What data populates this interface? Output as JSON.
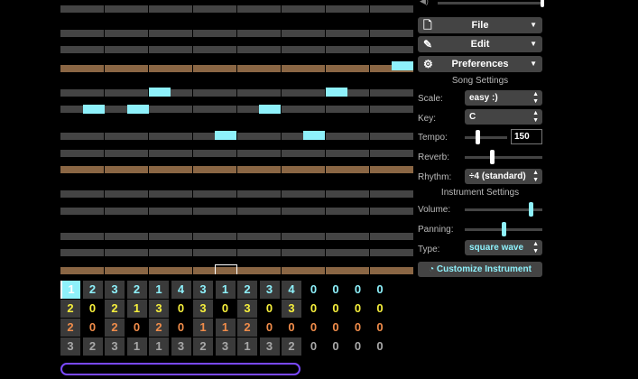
{
  "menus": {
    "file": {
      "label": "File",
      "icon": "file-icon"
    },
    "edit": {
      "label": "Edit",
      "icon": "pencil-icon"
    },
    "preferences": {
      "label": "Preferences",
      "icon": "gear-icon"
    }
  },
  "song_settings": {
    "title": "Song Settings",
    "scale_label": "Scale:",
    "scale_value": "easy :)",
    "key_label": "Key:",
    "key_value": "C",
    "tempo_label": "Tempo:",
    "tempo_value": "150",
    "reverb_label": "Reverb:",
    "rhythm_label": "Rhythm:",
    "rhythm_value": "÷4 (standard)"
  },
  "instrument_settings": {
    "title": "Instrument Settings",
    "volume_label": "Volume:",
    "panning_label": "Panning:",
    "type_label": "Type:",
    "type_value": "square wave",
    "customize_label": "Customize Instrument"
  },
  "colors": {
    "note": "#8ef1fb",
    "octave_row": "#8a6644",
    "row": "#444444",
    "channel1": "#8ef1fb",
    "channel2": "#f6ef3c",
    "channel3": "#f08c4a",
    "channel4": "#a8a8a8",
    "scrollbar": "#7a49ff"
  },
  "sliders": {
    "tempo_level": 0.3,
    "reverb_level": 0.35,
    "volume_level": 0.85,
    "panning_level": 0.5
  },
  "pattern_grid": {
    "rows": [
      {
        "channel": 1,
        "cells": [
          "1",
          "2",
          "3",
          "2",
          "1",
          "4",
          "3",
          "1",
          "2",
          "3",
          "4",
          "0",
          "0",
          "0",
          "0"
        ]
      },
      {
        "channel": 2,
        "cells": [
          "2",
          "0",
          "2",
          "1",
          "3",
          "0",
          "3",
          "0",
          "3",
          "0",
          "3",
          "0",
          "0",
          "0",
          "0"
        ]
      },
      {
        "channel": 3,
        "cells": [
          "2",
          "0",
          "2",
          "0",
          "2",
          "0",
          "1",
          "1",
          "2",
          "0",
          "0",
          "0",
          "0",
          "0",
          "0"
        ]
      },
      {
        "channel": 4,
        "cells": [
          "3",
          "2",
          "3",
          "1",
          "1",
          "3",
          "2",
          "3",
          "1",
          "3",
          "2",
          "0",
          "0",
          "0",
          "0"
        ]
      }
    ],
    "selected_cell": {
      "row": 0,
      "col": 0
    }
  }
}
